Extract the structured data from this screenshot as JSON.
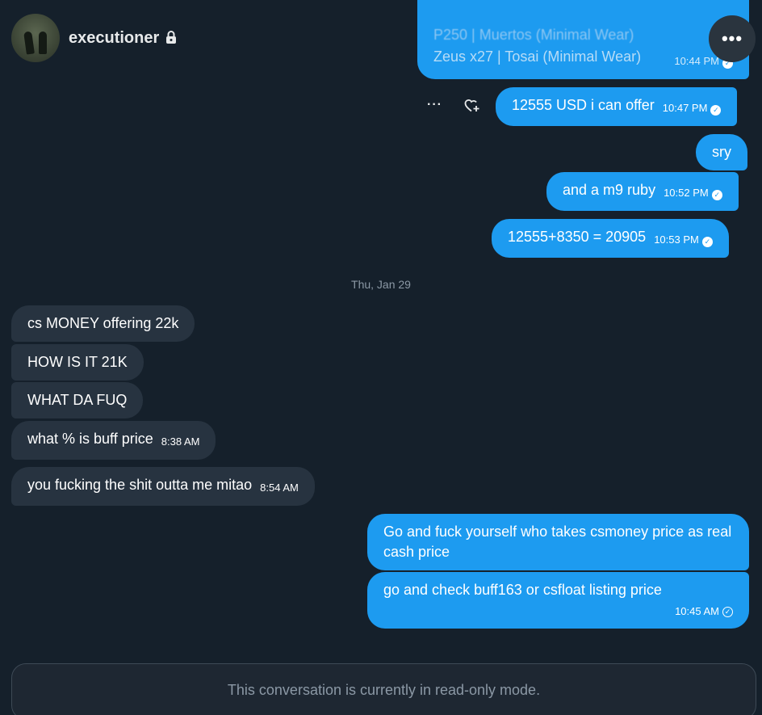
{
  "header": {
    "name": "executioner",
    "more_label": "•••"
  },
  "previous_message": {
    "line1": "P250 | Muertos (Minimal Wear)",
    "line2": "Zeus x27 | Tosai (Minimal Wear)",
    "time": "10:44 PM"
  },
  "actions": {
    "more_label": "···"
  },
  "messages_out_1": [
    {
      "text": "12555 USD i can offer",
      "time": "10:47 PM"
    },
    {
      "text": "sry"
    },
    {
      "text": "and a m9 ruby",
      "time": "10:52 PM"
    },
    {
      "text": "12555+8350 = 20905",
      "time": "10:53 PM"
    }
  ],
  "date_separator": "Thu, Jan 29",
  "messages_in": [
    {
      "text": "cs MONEY offering 22k"
    },
    {
      "text": "HOW IS IT 21K"
    },
    {
      "text": "WHAT DA FUQ"
    },
    {
      "text": "what % is buff price",
      "time": "8:38 AM"
    },
    {
      "text": "you fucking the shit outta me mitao",
      "time": "8:54 AM"
    }
  ],
  "messages_out_2": [
    {
      "text": "Go and fuck yourself who takes csmoney price as real cash price"
    },
    {
      "text": "go and check buff163 or csfloat listing price",
      "time": "10:45 AM"
    }
  ],
  "footer": {
    "readonly_text": "This conversation is currently in read-only mode."
  },
  "colors": {
    "background": "#15202b",
    "outgoing": "#1d9bf0",
    "incoming": "#273340"
  },
  "icons": [
    "lock-icon",
    "more-icon",
    "add-reaction-icon",
    "check-icon"
  ]
}
